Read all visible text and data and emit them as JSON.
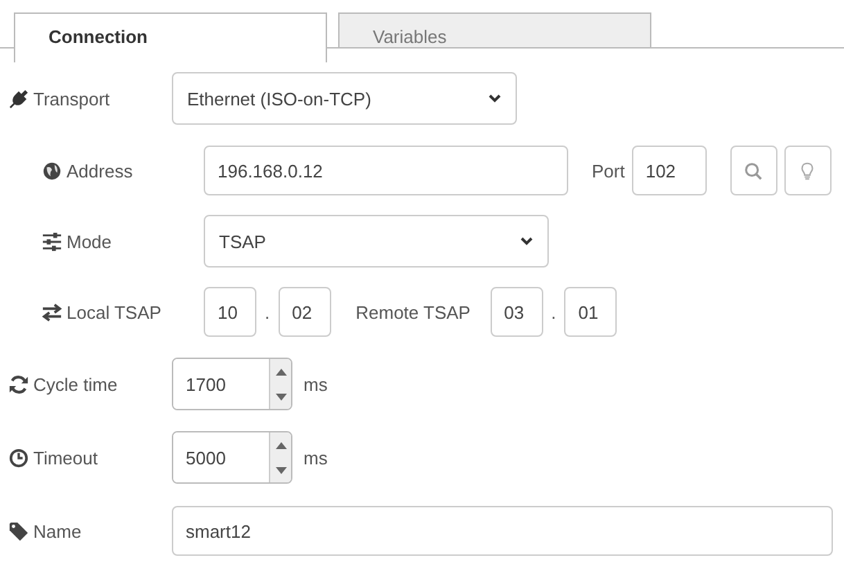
{
  "tabs": [
    {
      "label": "Connection",
      "selected": true
    },
    {
      "label": "Variables",
      "selected": false
    }
  ],
  "transport": {
    "label": "Transport",
    "value": "Ethernet (ISO-on-TCP)"
  },
  "address": {
    "label": "Address",
    "value": "196.168.0.12",
    "port_label": "Port",
    "port": "102"
  },
  "mode": {
    "label": "Mode",
    "value": "TSAP"
  },
  "tsap": {
    "local_label": "Local TSAP",
    "local": [
      "10",
      "02"
    ],
    "remote_label": "Remote TSAP",
    "remote": [
      "03",
      "01"
    ],
    "separator": "."
  },
  "cycle_time": {
    "label": "Cycle time",
    "value": "1700",
    "unit": "ms"
  },
  "timeout": {
    "label": "Timeout",
    "value": "5000",
    "unit": "ms"
  },
  "name": {
    "label": "Name",
    "value": "smart12"
  }
}
